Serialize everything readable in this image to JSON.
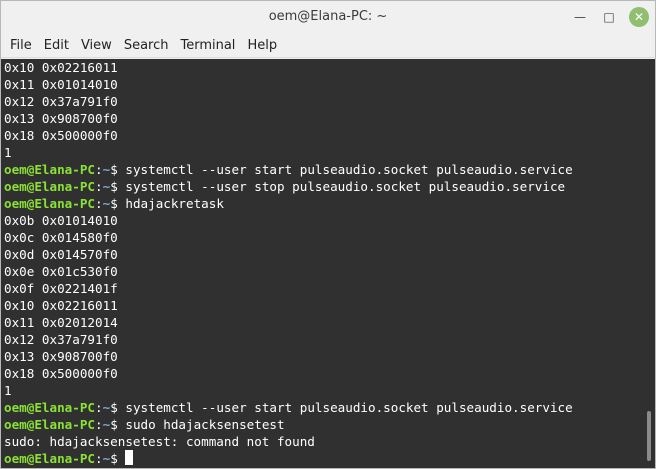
{
  "window": {
    "title": "oem@Elana-PC: ~",
    "minimize_glyph": "—",
    "maximize_glyph": "□",
    "close_glyph": "✕"
  },
  "menu": {
    "items": [
      "File",
      "Edit",
      "View",
      "Search",
      "Terminal",
      "Help"
    ]
  },
  "terminal": {
    "prompt_user": "oem@Elana-PC",
    "prompt_sep": ":",
    "prompt_path": "~",
    "prompt_symbol": "$ ",
    "lines": [
      {
        "type": "output",
        "text": "0x10 0x02216011"
      },
      {
        "type": "output",
        "text": "0x11 0x01014010"
      },
      {
        "type": "output",
        "text": "0x12 0x37a791f0"
      },
      {
        "type": "output",
        "text": "0x13 0x908700f0"
      },
      {
        "type": "output",
        "text": "0x18 0x500000f0"
      },
      {
        "type": "output",
        "text": "1"
      },
      {
        "type": "command",
        "text": "systemctl --user start pulseaudio.socket pulseaudio.service"
      },
      {
        "type": "command",
        "text": "systemctl --user stop pulseaudio.socket pulseaudio.service"
      },
      {
        "type": "command",
        "text": "hdajackretask"
      },
      {
        "type": "output",
        "text": "0x0b 0x01014010"
      },
      {
        "type": "output",
        "text": "0x0c 0x014580f0"
      },
      {
        "type": "output",
        "text": "0x0d 0x014570f0"
      },
      {
        "type": "output",
        "text": "0x0e 0x01c530f0"
      },
      {
        "type": "output",
        "text": "0x0f 0x0221401f"
      },
      {
        "type": "output",
        "text": "0x10 0x02216011"
      },
      {
        "type": "output",
        "text": "0x11 0x02012014"
      },
      {
        "type": "output",
        "text": "0x12 0x37a791f0"
      },
      {
        "type": "output",
        "text": "0x13 0x908700f0"
      },
      {
        "type": "output",
        "text": "0x18 0x500000f0"
      },
      {
        "type": "output",
        "text": "1"
      },
      {
        "type": "command",
        "text": "systemctl --user start pulseaudio.socket pulseaudio.service"
      },
      {
        "type": "command",
        "text": "sudo hdajacksensetest"
      },
      {
        "type": "output",
        "text": "sudo: hdajacksensetest: command not found"
      },
      {
        "type": "command",
        "text": "",
        "cursor": true
      }
    ]
  },
  "colors": {
    "prompt_user": "#8ae234",
    "prompt_path": "#7aa6da",
    "terminal_bg": "#303030",
    "terminal_fg": "#ffffff",
    "close_button": "#8fbf6f"
  }
}
